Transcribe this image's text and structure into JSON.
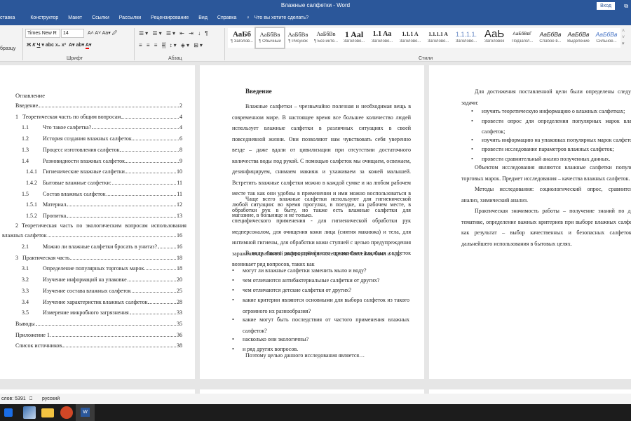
{
  "window": {
    "title": "Влажные салфетки  -  Word",
    "login": "Вход"
  },
  "tabs": [
    "ставка",
    "Конструктор",
    "Макет",
    "Ссылки",
    "Рассылки",
    "Рецензирование",
    "Вид",
    "Справка",
    "Что вы хотите сделать?"
  ],
  "ribbon": {
    "clipboard_partial": "бразцу",
    "font_name": "Times New R",
    "font_size": "14",
    "font_group": "Шрифт",
    "para_group": "Абзац",
    "styles_group": "Стили",
    "styles": [
      {
        "preview": "АаБб",
        "name": "¶ Заголов..."
      },
      {
        "preview": "АаБбВв",
        "name": "¶ Обычный"
      },
      {
        "preview": "АаБбВв",
        "name": "¶ Рисунок"
      },
      {
        "preview": "АаБбВв",
        "name": "¶ Без инте..."
      },
      {
        "preview": "1 Aal",
        "name": "Заголово..."
      },
      {
        "preview": "1.1 Aa",
        "name": "Заголово..."
      },
      {
        "preview": "1.1.1 A",
        "name": "Заголово..."
      },
      {
        "preview": "1.1.1.1 A",
        "name": "Заголово..."
      },
      {
        "preview": "1.1.1.1.",
        "name": "Заголово..."
      },
      {
        "preview": "АаЬ",
        "name": "Заголовок"
      },
      {
        "preview": "АаБбВвГ",
        "name": "Подзагол..."
      },
      {
        "preview": "АаБбВв",
        "name": "Слабое в..."
      },
      {
        "preview": "АаБбВв",
        "name": "Выделение"
      },
      {
        "preview": "АаБбВв",
        "name": "Сильное..."
      }
    ]
  },
  "page1": {
    "heading": "Оглавление",
    "toc": [
      {
        "num": "",
        "text": "Введение",
        "page": "2",
        "lvl": 0
      },
      {
        "num": "1",
        "text": "Теоретическая часть по общим вопросам",
        "page": "4",
        "lvl": 0
      },
      {
        "num": "1.1",
        "text": "Что такое салфетка?",
        "page": "4",
        "lvl": 1
      },
      {
        "num": "1.2",
        "text": "История создания влажных салфеток",
        "page": "6",
        "lvl": 1
      },
      {
        "num": "1.3",
        "text": "Процесс изготовления салфеток",
        "page": "8",
        "lvl": 1
      },
      {
        "num": "1.4",
        "text": "Разновидности влажных салфеток",
        "page": "9",
        "lvl": 1
      },
      {
        "num": "1.4.1",
        "text": "Гигиенические влажные салфетки",
        "page": "10",
        "lvl": 2
      },
      {
        "num": "1.4.2",
        "text": "Бытовые влажные салфетки:",
        "page": "11",
        "lvl": 2
      },
      {
        "num": "1.5",
        "text": "Состав влажных салфеток",
        "page": "11",
        "lvl": 1
      },
      {
        "num": "1.5.1",
        "text": "Материал",
        "page": "12",
        "lvl": 2
      },
      {
        "num": "1.5.2",
        "text": "Пропитка",
        "page": "13",
        "lvl": 2
      }
    ],
    "toc_ch2_line1": "2  Теоретическая часть по экологическим вопросам использования",
    "toc_ch2_line2": "влажных салфеток",
    "toc_ch2_page": "16",
    "toc2": [
      {
        "num": "2.1",
        "text": "Можно ли влажные салфетки бросать в унитаз?",
        "page": "16",
        "lvl": 1
      },
      {
        "num": "3",
        "text": "Практическая часть",
        "page": "18",
        "lvl": 0
      },
      {
        "num": "3.1",
        "text": "Определение популярных торговых марок",
        "page": "18",
        "lvl": 1
      },
      {
        "num": "3.2",
        "text": "Изучение информаций на упаковке",
        "page": "20",
        "lvl": 1
      },
      {
        "num": "3.3",
        "text": "Изучение состава влажных салфеток",
        "page": "25",
        "lvl": 1
      },
      {
        "num": "3.4",
        "text": "Изучение характеристик влажных салфеток",
        "page": "28",
        "lvl": 1
      },
      {
        "num": "3.5",
        "text": "Измерение микробного загрязнения",
        "page": "33",
        "lvl": 1
      },
      {
        "num": "",
        "text": "Выводы",
        "page": "35",
        "lvl": -1
      },
      {
        "num": "",
        "text": "Приложение 1",
        "page": "36",
        "lvl": -1
      },
      {
        "num": "",
        "text": "Список источников",
        "page": "38",
        "lvl": -1
      }
    ]
  },
  "page2": {
    "heading": "Введение",
    "para1": "Влажные салфетки – чрезвычайно полезная и необходимая вещь в современном мире. В настоящее время все большее количество людей использует влажные салфетки в различных ситуациях в своей повседневной жизни. Они позволяют нам чувствовать себя уверенно везде – даже вдали от цивилизации при отсутствии достаточного количества воды под рукой. С помощью салфеток мы очищаем, освежаем, дезинфицируем, снимаем макияж и ухаживаем за кожей малышей. Встретить влажные салфетки можно в каждой сумке и на любом рабочем месте так как они удобны в применении и ими можно воспользоваться в любой ситуации: во время прогулки, в поездке, на рабочем месте, в магазине, в больнице и не только.",
    "para2": "Чаще всего влажные салфетки используют для гигиенической обработки рук в быту, но также есть влажные салфетки для специфического применения - для гигиенической обработки рук медперсоналом, для очищения кожи лица (снятия макияжа) и тела, для интимной гигиены, для обработки кожи ступней с целью предупреждения заражения грибковой инфекцией при посещении бассейна, бани и т.д.;",
    "para3": "В виду такого распространённого применения влажных салфеток возникает ряд вопросов, таких как",
    "bullets": [
      "могут ли влажные салфетки заменить мыло и воду?",
      "чем отличаются антибактериальные салфетки от других?",
      "чем отличаются детские салфетки от других?",
      "какие критерии являются основными для выбора салфеток из такого огромного их разнообразия?",
      "какие могут быть последствия от частого применения влажных салфеток?",
      "насколько они экологичны?",
      "и ряд других вопросов."
    ],
    "para4": "Поэтому целью данного исследования является…"
  },
  "page3": {
    "para1": "Для достижения поставленной цели были определены следующие задачи:",
    "bullets": [
      "изучить теоретическую информацию о влажных салфетках;",
      "провести опрос для определения популярных марок влажных салфеток;",
      "изучить информацию на упаковках популярных марок салфеток;",
      "провести исследование параметров влажных салфеток;",
      "провести сравнительный анализ полученных данных."
    ],
    "para2": "Объектом исследования являются влажные салфетки популярных торговых марок. Предмет исследования – качества влажных салфеток.",
    "para3": "Методы исследования: социологический опрос, сравнительный анализ, химический анализ.",
    "para4": "Практическая значимость работы – получение знаний по данной тематике, определение важных критериев при выборе влажных салфеток и как результат – выбор качественных и безопасных салфеток для дальнейшего использования в бытовых целях."
  },
  "status": {
    "words": "слов: 5391",
    "language": "русский"
  }
}
